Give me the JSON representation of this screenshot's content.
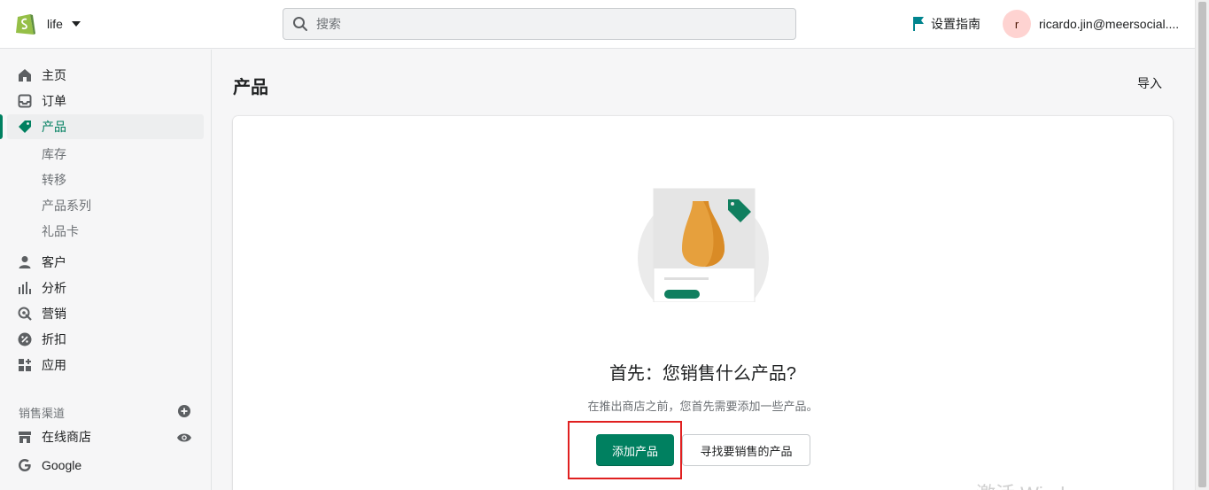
{
  "topbar": {
    "store_name": "life",
    "search_placeholder": "搜索",
    "setup_guide_label": "设置指南",
    "avatar_initial": "r",
    "account_email": "ricardo.jin@meersocial...."
  },
  "sidebar": {
    "items": [
      {
        "label": "主页",
        "icon": "home-icon"
      },
      {
        "label": "订单",
        "icon": "orders-icon"
      },
      {
        "label": "产品",
        "icon": "tag-icon",
        "active": true
      },
      {
        "label": "客户",
        "icon": "customer-icon"
      },
      {
        "label": "分析",
        "icon": "analytics-icon"
      },
      {
        "label": "营销",
        "icon": "marketing-icon"
      },
      {
        "label": "折扣",
        "icon": "discount-icon"
      },
      {
        "label": "应用",
        "icon": "apps-icon"
      }
    ],
    "product_subitems": [
      "库存",
      "转移",
      "产品系列",
      "礼品卡"
    ],
    "sales_channels_heading": "销售渠道",
    "channels": [
      {
        "label": "在线商店",
        "icon": "store-icon"
      },
      {
        "label": "Google",
        "icon": "google-icon"
      }
    ]
  },
  "main": {
    "page_title": "产品",
    "import_label": "导入",
    "empty_state": {
      "title": "首先：您销售什么产品?",
      "description": "在推出商店之前，您首先需要添加一些产品。",
      "primary_action": "添加产品",
      "secondary_action": "寻找要销售的产品"
    }
  },
  "watermark_text": "激活 Windows",
  "colors": {
    "accent_green": "#008060",
    "active_text": "#007f5f",
    "highlight_red": "#e02020",
    "avatar_bg": "#fed3d1",
    "guide_flag": "#00848e"
  }
}
